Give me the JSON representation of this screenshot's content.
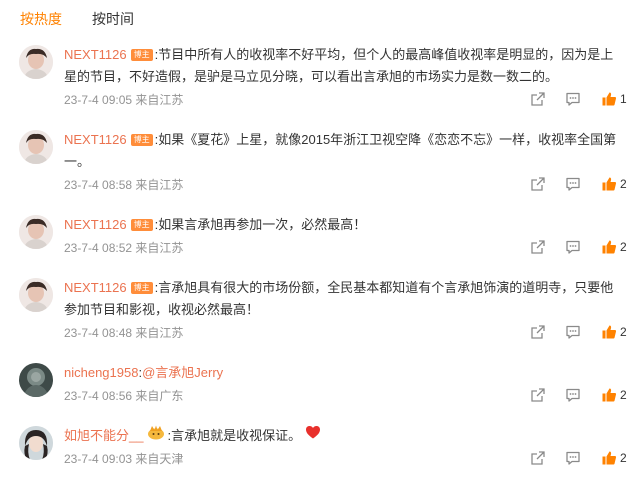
{
  "tabs": {
    "hot": "按热度",
    "time": "按时间"
  },
  "colors": {
    "accent": "#ff8200",
    "username": "#eb7350",
    "meta": "#939393",
    "like": "#ff8200"
  },
  "icons": {
    "share": "share-icon",
    "reply": "comment-icon",
    "like": "thumbs-up-icon"
  },
  "comments": [
    {
      "user": "NEXT1126",
      "badge": "博主",
      "text": ":节目中所有人的收视率不好平均，但个人的最高峰值收视率是明显的，因为是上星的节目，不好造假，是驴是马立见分晓，可以看出言承旭的市场实力是数一数二的。",
      "time": "23-7-4 09:05 来自江苏",
      "likes": "1"
    },
    {
      "user": "NEXT1126",
      "badge": "博主",
      "text": ":如果《夏花》上星，就像2015年浙江卫视空降《恋恋不忘》一样，收视率全国第一。",
      "time": "23-7-4 08:58 来自江苏",
      "likes": "2"
    },
    {
      "user": "NEXT1126",
      "badge": "博主",
      "text": ":如果言承旭再参加一次，必然最高！",
      "time": "23-7-4 08:52 来自江苏",
      "likes": "2"
    },
    {
      "user": "NEXT1126",
      "badge": "博主",
      "text": ":言承旭具有很大的市场份额，全民基本都知道有个言承旭饰演的道明寺，只要他参加节目和影视，收视必然最高！",
      "time": "23-7-4 08:48 来自江苏",
      "likes": "2"
    },
    {
      "user": "nicheng1958",
      "badge": "",
      "mention": "@言承旭Jerry",
      "text": ":",
      "time": "23-7-4 08:56 来自广东",
      "likes": "2"
    },
    {
      "user": "如旭不能分__",
      "badge": "",
      "text": ":言承旭就是收视保证。",
      "time": "23-7-4 09:03 来自天津",
      "likes": "2"
    }
  ]
}
